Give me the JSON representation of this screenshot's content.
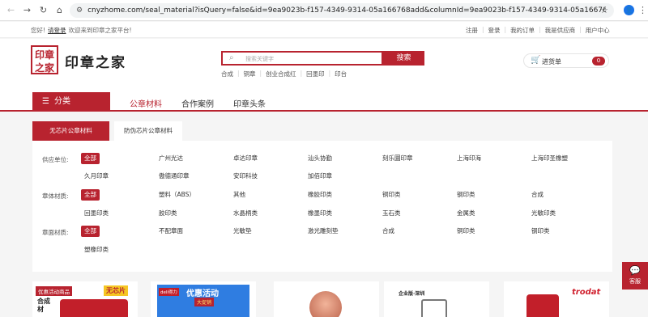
{
  "browser": {
    "url": "cnyzhome.com/seal_material?isQuery=false&id=9ea9023b-f157-4349-9314-05a166768add&columnId=9ea9023b-f157-4349-9314-05a166768add&chapt...",
    "profile_initial": "👤"
  },
  "topstrip": {
    "hello": "您好!",
    "login": "请登录",
    "welcome": "欢迎来到印章之家平台!",
    "links": [
      "注册",
      "登录",
      "我的订单",
      "我是供应商",
      "用户中心"
    ]
  },
  "header": {
    "logo_mark": "印章之家",
    "logo_text": "印章之家",
    "search_placeholder": "搜索关键字",
    "search_button": "搜索",
    "hotwords": [
      "合成",
      "铜章",
      "创业合成红",
      "回墨印",
      "印台"
    ],
    "cart_label": "进货单",
    "cart_count": "0"
  },
  "nav": {
    "category_button": "分类",
    "links": [
      "公章材料",
      "合作案例",
      "印章头条"
    ]
  },
  "subtabs": [
    "无芯片公章材料",
    "防伪芯片公章材料"
  ],
  "filters": {
    "supplier": {
      "label": "供应单位:",
      "all": "全部",
      "options": [
        "广州光达",
        "卓达印章",
        "汕头协勤",
        "刻乐圜印章",
        "上海印海",
        "上海印圣橡塑",
        "久月印章",
        "傲德通印章",
        "安印科技",
        "加佰印章"
      ]
    },
    "body_material": {
      "label": "章体材质:",
      "all": "全部",
      "options": [
        "塑料（ABS）",
        "其他",
        "橡胶印类",
        "铜印类",
        "钢印类",
        "合成",
        "回墨印类",
        "胶印类",
        "水晶柄类",
        "橡墨印类",
        "玉石类",
        "金属类",
        "光敏印类"
      ]
    },
    "face_material": {
      "label": "章面材质:",
      "all": "全部",
      "options": [
        "不配章面",
        "光敏垫",
        "激光雕刻垫",
        "合成",
        "铜印类",
        "钢印类",
        "塑橡印类"
      ]
    }
  },
  "products": {
    "card1": {
      "tag": "优惠活动商品",
      "badge": "无芯片",
      "sub": "合成材"
    },
    "card2": {
      "brand": "deli得力",
      "banner": "优惠活动",
      "banner_sub": "大促销"
    },
    "card4": {
      "label": "企业版·深圳"
    },
    "card5": {
      "brand": "trodat"
    }
  },
  "service": {
    "label": "客服"
  },
  "colors": {
    "brand_red": "#b8232f"
  }
}
